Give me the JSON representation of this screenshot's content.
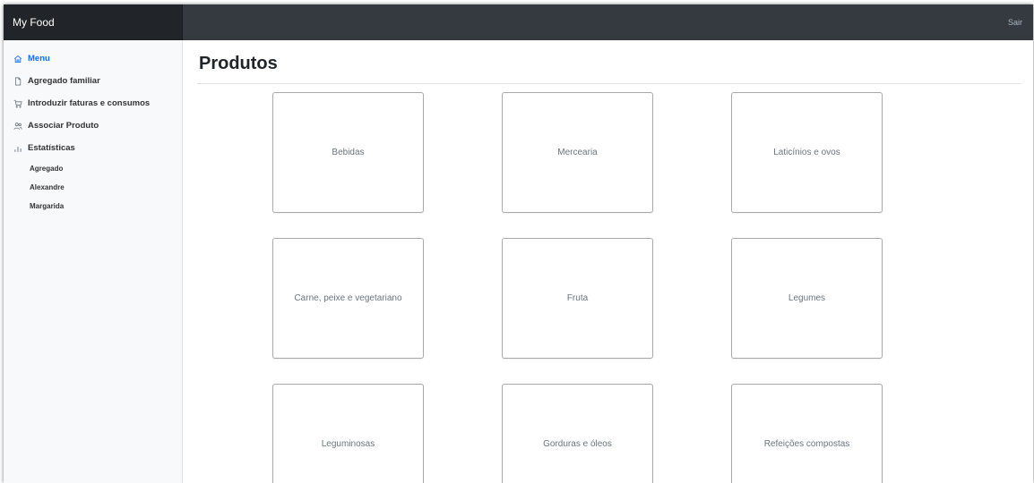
{
  "app": {
    "title": "My Food",
    "signout_label": "Sair"
  },
  "sidebar": {
    "items": [
      {
        "label": "Menu",
        "icon": "home-icon",
        "active": true
      },
      {
        "label": "Agregado familiar",
        "icon": "file-icon"
      },
      {
        "label": "Introduzir faturas e consumos",
        "icon": "cart-icon"
      },
      {
        "label": "Associar Produto",
        "icon": "users-icon"
      },
      {
        "label": "Estatísticas",
        "icon": "bar-chart-icon"
      }
    ],
    "sub_items": [
      "Agregado",
      "Alexandre",
      "Margarida"
    ]
  },
  "main": {
    "title": "Produtos",
    "categories": [
      "Bebidas",
      "Mercearia",
      "Laticínios e ovos",
      "Carne, peixe e vegetariano",
      "Fruta",
      "Legumes",
      "Leguminosas",
      "Gorduras e óleos",
      "Refeições compostas"
    ]
  },
  "colors": {
    "topbar": "#343a40",
    "brand_bg": "#212529",
    "sidebar_bg": "#f8f9fa",
    "accent": "#0d6efd"
  }
}
